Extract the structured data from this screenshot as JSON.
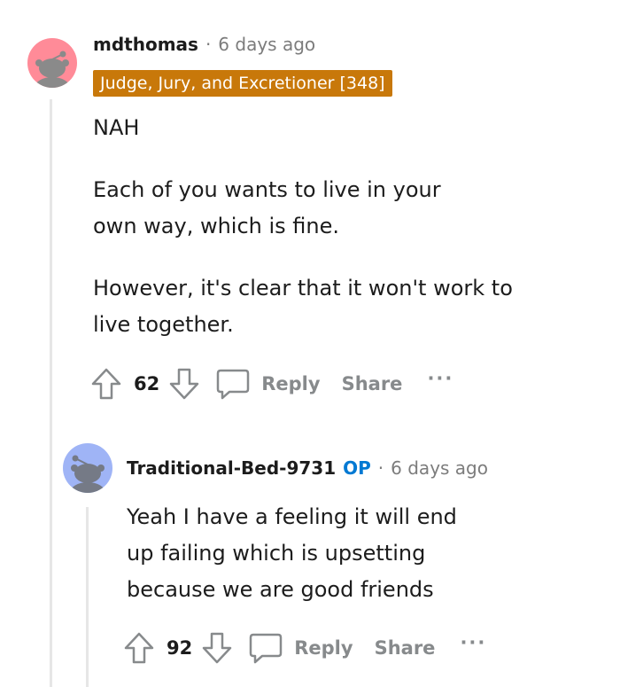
{
  "comment1": {
    "username": "mdthomas",
    "separator": "·",
    "time": "6 days ago",
    "flair": "Judge, Jury, and Excretioner [348]",
    "paragraphs": [
      "NAH",
      "Each of you wants to live in your own way, which is fine.",
      "However, it's clear that it won't work to live together."
    ],
    "score": "62",
    "reply_label": "Reply",
    "share_label": "Share",
    "more_label": "···",
    "avatar_color": "#ff8b98"
  },
  "comment2": {
    "username": "Traditional-Bed-9731",
    "op_badge": "OP",
    "separator": "·",
    "time": "6 days ago",
    "paragraphs": [
      "Yeah I have a feeling it will end up failing which is upsetting because we are good friends"
    ],
    "score": "92",
    "reply_label": "Reply",
    "share_label": "Share",
    "more_label": "···",
    "avatar_color": "#9fb4f6"
  }
}
